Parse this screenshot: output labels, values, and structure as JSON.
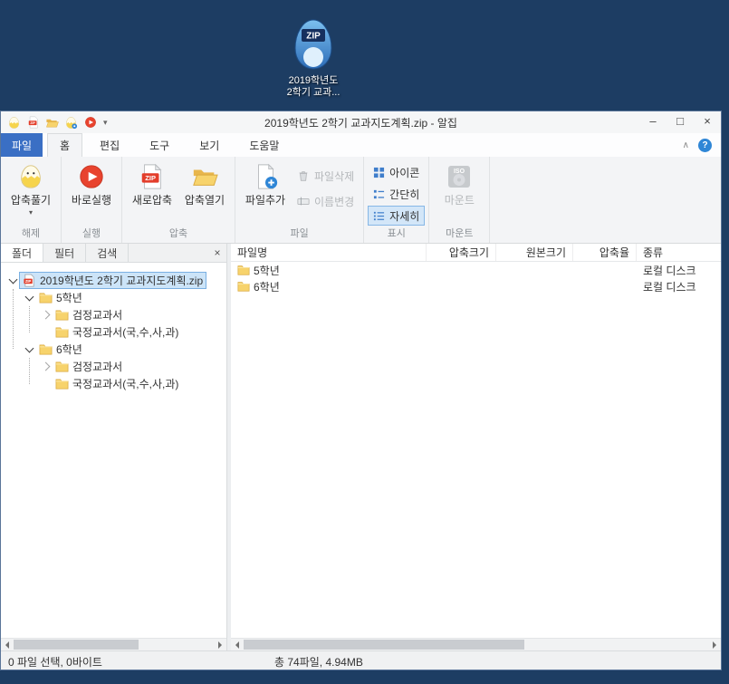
{
  "colors": {
    "brand_blue": "#3a6fc4",
    "desktop_bg": "#1d3d63",
    "selection": "#cce4f8",
    "zip_red": "#e33e2b"
  },
  "icons": {
    "zip_badge": "ZIP",
    "iso_badge": "ISO"
  },
  "desktop": {
    "icon_label_line1": "2019학년도",
    "icon_label_line2": "2학기 교과...",
    "icon_badge": "ZIP"
  },
  "window": {
    "title": "2019학년도 2학기 교과지도계획.zip - 알집",
    "minimize": "–",
    "maximize": "□",
    "close": "×"
  },
  "menu": {
    "file_tab": "파일",
    "home": "홈",
    "edit": "편집",
    "tools": "도구",
    "view": "보기",
    "help": "도움말",
    "collapse_glyph": "∧",
    "help_glyph": "?"
  },
  "ribbon": {
    "extract": "압축풀기",
    "extract_caret": "▾",
    "group_extract": "해제",
    "run": "바로실행",
    "group_run": "실행",
    "new_archive": "새로압축",
    "open_archive": "압축열기",
    "group_archive": "압축",
    "add_file": "파일추가",
    "delete_file": "파일삭제",
    "rename": "이름변경",
    "group_file": "파일",
    "view_icon": "아이콘",
    "view_simple": "간단히",
    "view_detail": "자세히",
    "group_view": "표시",
    "mount": "마운트",
    "group_mount": "마운트"
  },
  "left_pane": {
    "tab_folder": "폴더",
    "tab_filter": "필터",
    "tab_search": "검색",
    "close_glyph": "×",
    "tree": [
      {
        "label": "2019학년도 2학기 교과지도계획.zip"
      },
      {
        "label": "5학년"
      },
      {
        "label": "검정교과서"
      },
      {
        "label": "국정교과서(국,수,사,과)"
      },
      {
        "label": "6학년"
      },
      {
        "label": "검정교과서"
      },
      {
        "label": "국정교과서(국,수,사,과)"
      }
    ]
  },
  "file_list": {
    "col_name": "파일명",
    "col_packed": "압축크기",
    "col_size": "원본크기",
    "col_ratio": "압축율",
    "col_type": "종류",
    "rows": [
      {
        "name": "5학년",
        "type": "로컬 디스크"
      },
      {
        "name": "6학년",
        "type": "로컬 디스크"
      }
    ]
  },
  "status": {
    "selection": "0 파일 선택, 0바이트",
    "total": "총 74파일, 4.94MB"
  }
}
